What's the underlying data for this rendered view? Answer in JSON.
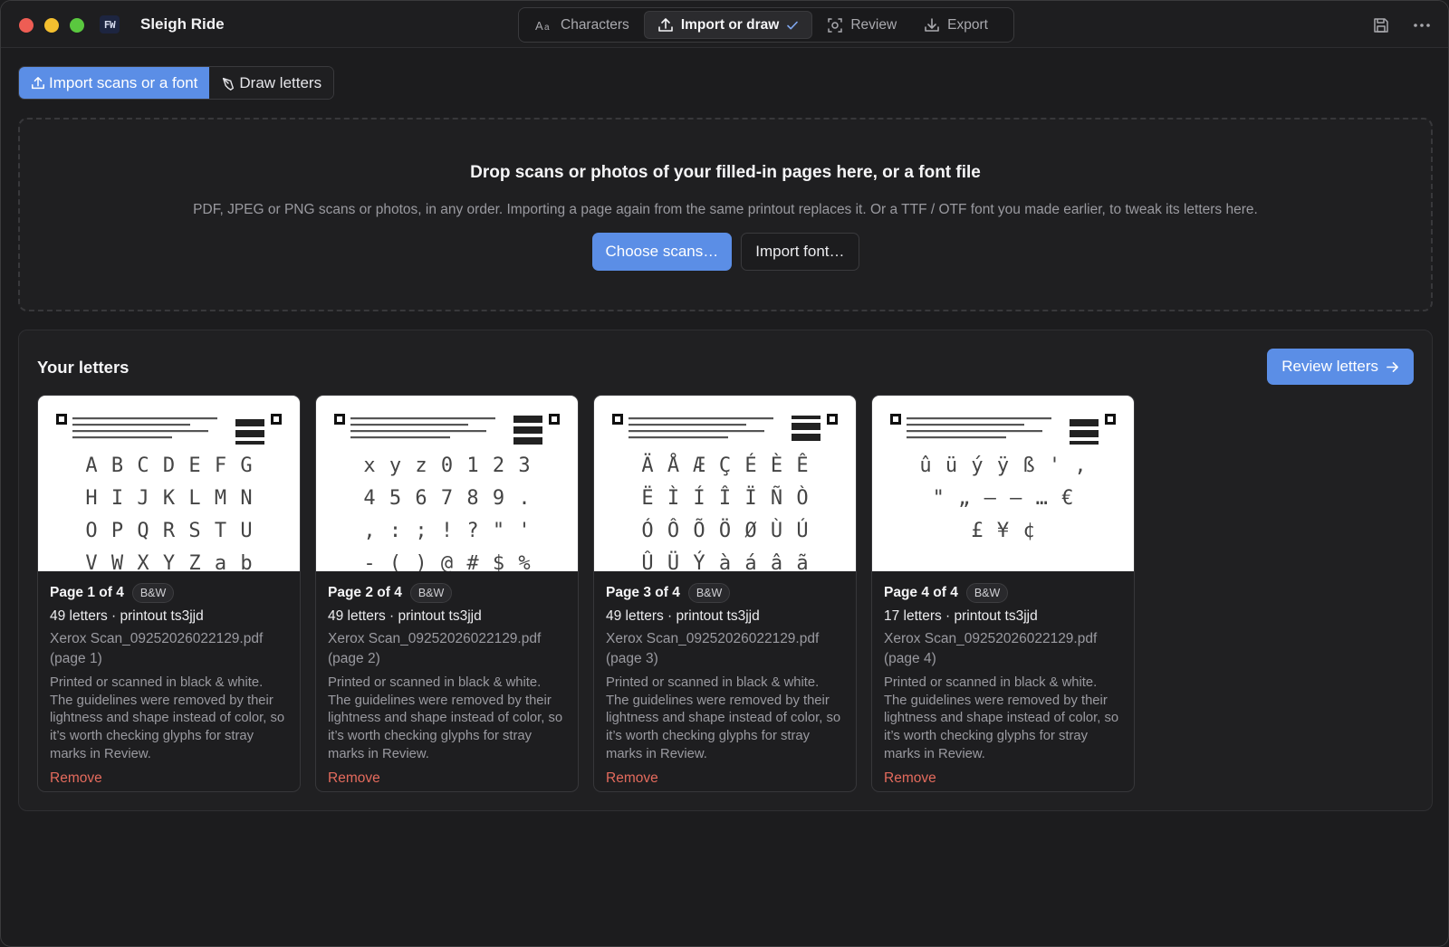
{
  "window": {
    "app_icon_text": "FW",
    "title": "Sleigh Ride"
  },
  "toolbar": {
    "tabs": [
      {
        "label": "Characters",
        "icon": "text-format-icon"
      },
      {
        "label": "Import or draw",
        "icon": "upload-icon",
        "active": true,
        "completed": true
      },
      {
        "label": "Review",
        "icon": "review-icon"
      },
      {
        "label": "Export",
        "icon": "download-icon"
      }
    ],
    "right_icons": [
      "save-icon",
      "more-icon"
    ]
  },
  "mode_tabs": [
    {
      "label": "Import scans or a font",
      "icon": "upload-icon",
      "active": true
    },
    {
      "label": "Draw letters",
      "icon": "pen-icon",
      "active": false
    }
  ],
  "dropzone": {
    "title": "Drop scans or photos of your filled-in pages here, or a font file",
    "subtitle": "PDF, JPEG or PNG scans or photos, in any order. Importing a page again from the same printout replaces it. Or a TTF / OTF font you made earlier, to tweak its letters here.",
    "primary_button": "Choose scans…",
    "secondary_button": "Import font…"
  },
  "letters": {
    "title": "Your letters",
    "review_button": "Review letters",
    "cards": [
      {
        "page": "Page 1 of 4",
        "badge": "B&W",
        "count": "49 letters · printout ts3jjd",
        "file": "Xerox Scan_09252026022129.pdf (page 1)",
        "description": "Printed or scanned in black & white. The guidelines were removed by their lightness and shape instead of color, so it’s worth checking glyphs for stray marks in Review.",
        "remove": "Remove",
        "glyph_rows": [
          "A B C D E F G",
          "H I J K L M N",
          "O P Q R S T U",
          "V W X Y Z a b"
        ]
      },
      {
        "page": "Page 2 of 4",
        "badge": "B&W",
        "count": "49 letters · printout ts3jjd",
        "file": "Xerox Scan_09252026022129.pdf (page 2)",
        "description": "Printed or scanned in black & white. The guidelines were removed by their lightness and shape instead of color, so it’s worth checking glyphs for stray marks in Review.",
        "remove": "Remove",
        "glyph_rows": [
          "x y z 0 1 2 3",
          "4 5 6 7 8 9 .",
          ", : ; ! ? \" '",
          "- ( ) @ # $ %"
        ]
      },
      {
        "page": "Page 3 of 4",
        "badge": "B&W",
        "count": "49 letters · printout ts3jjd",
        "file": "Xerox Scan_09252026022129.pdf (page 3)",
        "description": "Printed or scanned in black & white. The guidelines were removed by their lightness and shape instead of color, so it’s worth checking glyphs for stray marks in Review.",
        "remove": "Remove",
        "glyph_rows": [
          "Ä Å Æ Ç É È Ê",
          "Ë Ì Í Î Ï Ñ Ò",
          "Ó Ô Õ Ö Ø Ù Ú",
          "Û Ü Ý à á â ã"
        ]
      },
      {
        "page": "Page 4 of 4",
        "badge": "B&W",
        "count": "17 letters · printout ts3jjd",
        "file": "Xerox Scan_09252026022129.pdf (page 4)",
        "description": "Printed or scanned in black & white. The guidelines were removed by their lightness and shape instead of color, so it’s worth checking glyphs for stray marks in Review.",
        "remove": "Remove",
        "glyph_rows": [
          "û ü ý ÿ ß ' ‚",
          "\" „ – — … € ",
          "£ ¥ ¢"
        ]
      }
    ]
  },
  "colors": {
    "accent": "#5b8ee6",
    "danger": "#e46b5d",
    "background": "#1c1c1e"
  }
}
